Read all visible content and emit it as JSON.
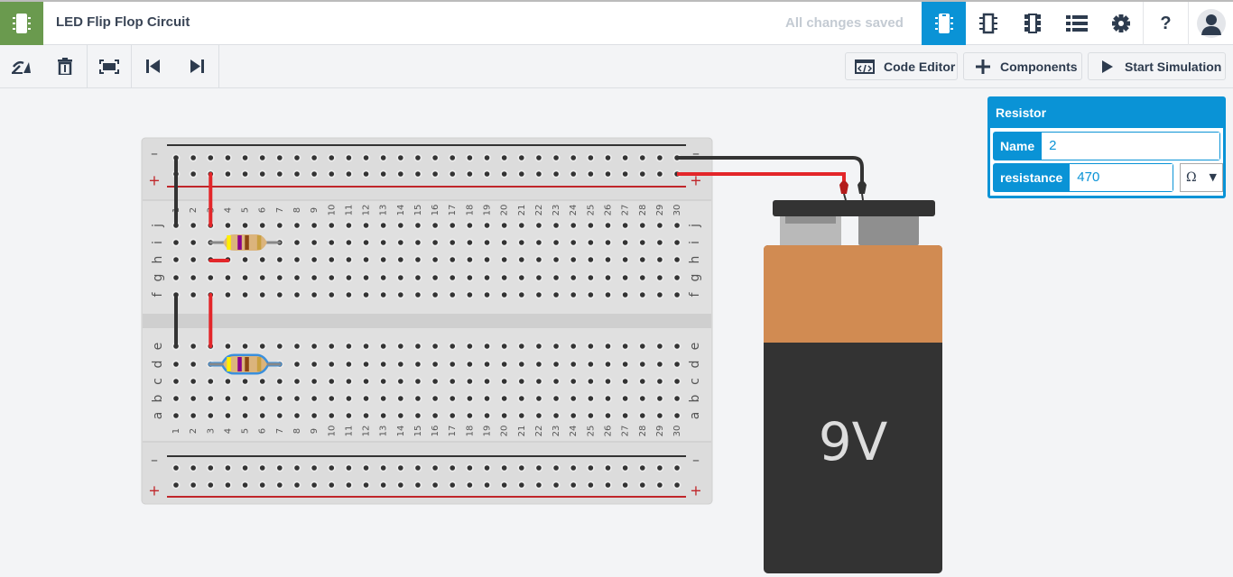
{
  "header": {
    "title": "LED Flip Flop Circuit",
    "save_status": "All changes saved",
    "nav_icons": [
      "circuit-view-icon",
      "schematic-view-icon",
      "component-list-icon",
      "list-icon",
      "settings-icon",
      "help-icon",
      "user-avatar-icon"
    ],
    "help_label": "?",
    "accent": "#0a93d6",
    "logo_color": "#6a9a4e"
  },
  "toolbar": {
    "tools": [
      "rotate-icon",
      "delete-icon",
      "fit-view-icon",
      "step-back-icon",
      "step-forward-icon"
    ],
    "code_editor": "Code Editor",
    "components": "Components",
    "start_simulation": "Start Simulation"
  },
  "inspector": {
    "title": "Resistor",
    "name_label": "Name",
    "name_value": "2",
    "resistance_label": "resistance",
    "resistance_value": "470",
    "unit": "Ω"
  },
  "breadboard": {
    "columns": 30,
    "top_rows": [
      "j",
      "i",
      "h",
      "g",
      "f"
    ],
    "bottom_rows": [
      "e",
      "d",
      "c",
      "b",
      "a"
    ],
    "minus": "–",
    "plus": "+"
  },
  "resistors": [
    {
      "row": "i",
      "from": 3,
      "to": 7,
      "selected": false
    },
    {
      "row": "d",
      "from": 3,
      "to": 7,
      "selected": true
    }
  ],
  "battery": {
    "label": "9V"
  }
}
